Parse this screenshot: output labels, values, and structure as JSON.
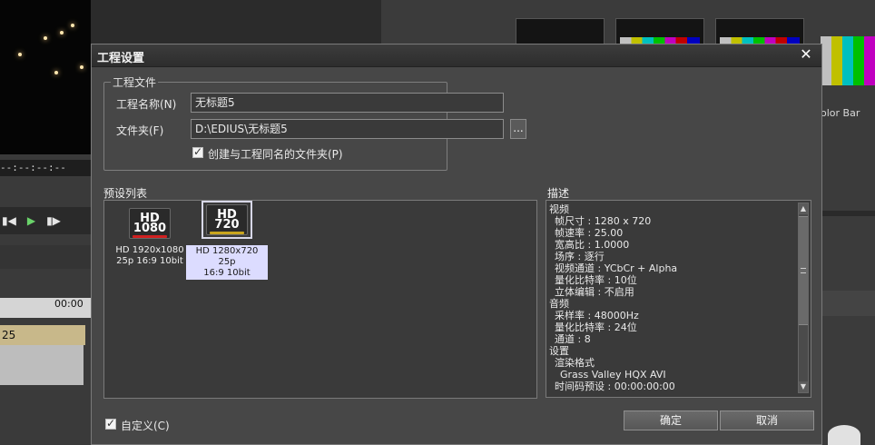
{
  "background": {
    "timecode": "--:--:--:--",
    "ruler_label": "00:00",
    "clip_label": "25",
    "right_panel_label": "olor Bar"
  },
  "dialog": {
    "title": "工程设置",
    "close_label": "✕",
    "project_file": {
      "legend": "工程文件",
      "name_label": "工程名称(N)",
      "name_value": "无标题5",
      "folder_label": "文件夹(F)",
      "folder_value": "D:\\EDIUS\\无标题5",
      "browse_label": "...",
      "create_folder_label": "创建与工程同名的文件夹(P)"
    },
    "preset_list": {
      "label": "预设列表",
      "items": [
        {
          "icon_top": "HD",
          "icon_bottom": "1080",
          "line1": "HD 1920x1080",
          "line2": "25p 16:9 10bit"
        },
        {
          "icon_top": "HD",
          "icon_bottom": "720",
          "line1": "HD 1280x720 25p",
          "line2": "16:9 10bit"
        }
      ]
    },
    "description": {
      "label": "描述",
      "lines": [
        {
          "text": "视频",
          "indent": 0
        },
        {
          "text": "帧尺寸 : 1280 x 720",
          "indent": 1
        },
        {
          "text": "帧速率 : 25.00",
          "indent": 1
        },
        {
          "text": "宽高比 : 1.0000",
          "indent": 1
        },
        {
          "text": "场序 : 逐行",
          "indent": 1
        },
        {
          "text": "视频通道 : YCbCr + Alpha",
          "indent": 1
        },
        {
          "text": "量化比特率 : 10位",
          "indent": 1
        },
        {
          "text": "立体编辑 : 不启用",
          "indent": 1
        },
        {
          "text": "音频",
          "indent": 0
        },
        {
          "text": "采样率 : 48000Hz",
          "indent": 1
        },
        {
          "text": "量化比特率 : 24位",
          "indent": 1
        },
        {
          "text": "通道 : 8",
          "indent": 1
        },
        {
          "text": "设置",
          "indent": 0
        },
        {
          "text": "渲染格式",
          "indent": 1
        },
        {
          "text": "Grass Valley HQX AVI",
          "indent": 2
        },
        {
          "text": "时间码预设 : 00:00:00:00",
          "indent": 1
        }
      ]
    },
    "customize_label": "自定义(C)",
    "ok_label": "确定",
    "cancel_label": "取消"
  }
}
